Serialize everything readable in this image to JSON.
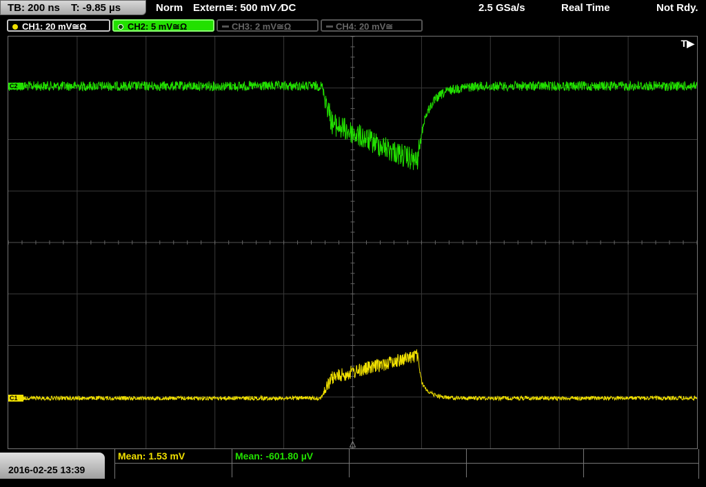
{
  "status": {
    "timebase": "TB: 200 ns",
    "trigger_time": "T: -9.85 µs",
    "trigger_mode": "Norm",
    "trigger_source": "Extern≅: 500 mV ⁄DC",
    "sample_rate": "2.5 GSa/s",
    "acq_mode": "Real Time",
    "state": "Not Rdy."
  },
  "channels": [
    {
      "label": "CH1: 20 mV≅Ω",
      "active": true
    },
    {
      "label": "CH2: 5 mV≅Ω",
      "active": true
    },
    {
      "label": "CH3: 2 mV≅Ω",
      "active": false
    },
    {
      "label": "CH4: 20 mV≅",
      "active": false
    }
  ],
  "plot": {
    "trigger_indicator": "T▶",
    "ch1_marker": "C1",
    "ch2_marker": "C2"
  },
  "footer": {
    "datetime": "2016-02-25 13:39",
    "measurements": [
      {
        "label": "Mean: 1.53 mV",
        "color": "#f0e000"
      },
      {
        "label": "Mean: -601.80 µV",
        "color": "#22e000"
      }
    ]
  },
  "colors": {
    "ch1": "#f0e000",
    "ch2": "#22e000",
    "grid": "#3a3a3a"
  }
}
